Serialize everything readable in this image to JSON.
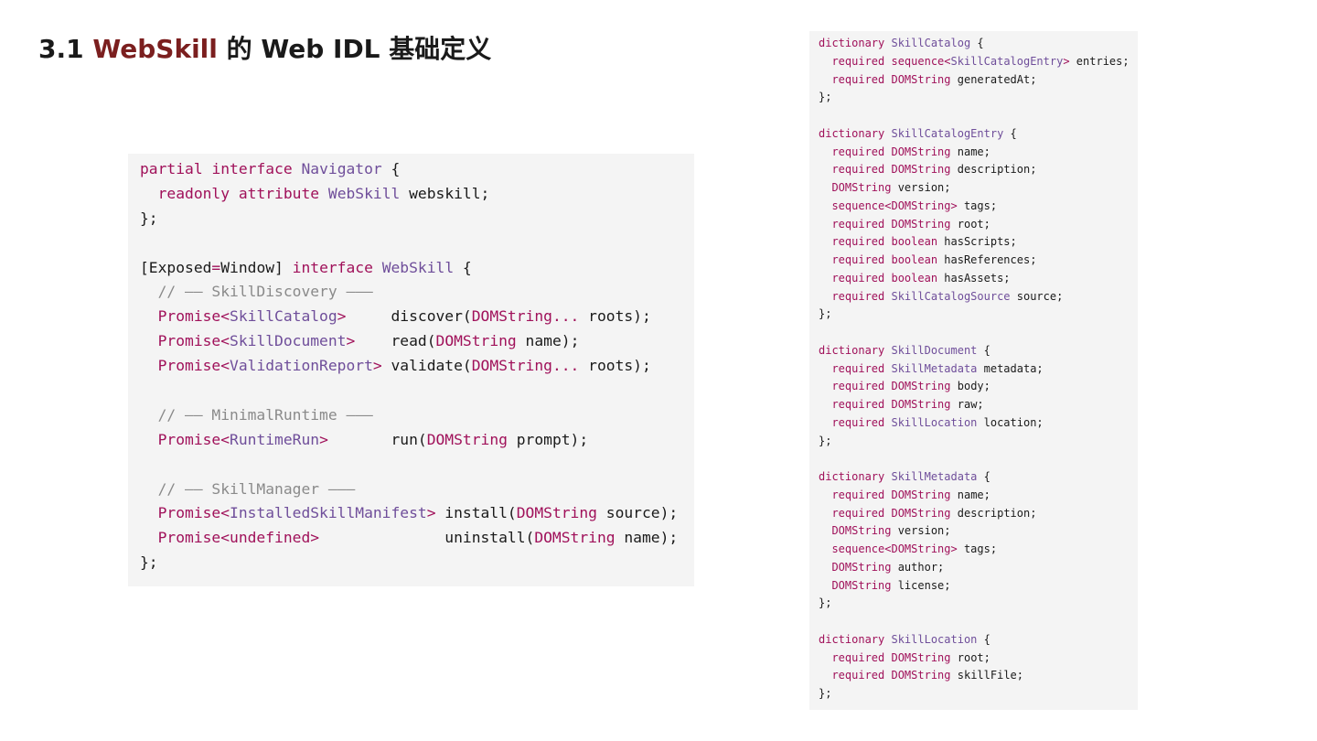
{
  "title": {
    "prefix": "3.1 ",
    "brand": "WebSkill",
    "suffix": " 的 Web IDL 基础定义"
  },
  "colors": {
    "brand": "#7b1f1f",
    "keyword": "#a0115a",
    "type": "#6f4e9a",
    "comment": "#8a8a8a",
    "text": "#1a1a1a",
    "code_background": "#f4f4f4"
  },
  "left_code": [
    [
      [
        "kw",
        "partial"
      ],
      [
        "pl",
        " "
      ],
      [
        "kw",
        "interface"
      ],
      [
        "pl",
        " "
      ],
      [
        "ty",
        "Navigator"
      ],
      [
        "pl",
        " {"
      ]
    ],
    [
      [
        "pl",
        "  "
      ],
      [
        "kw",
        "readonly"
      ],
      [
        "pl",
        " "
      ],
      [
        "kw",
        "attribute"
      ],
      [
        "pl",
        " "
      ],
      [
        "ty",
        "WebSkill"
      ],
      [
        "pl",
        " webskill;"
      ]
    ],
    [
      [
        "pl",
        "};"
      ]
    ],
    [],
    [
      [
        "pl",
        "[Exposed"
      ],
      [
        "kw",
        "="
      ],
      [
        "pl",
        "Window] "
      ],
      [
        "kw",
        "interface"
      ],
      [
        "pl",
        " "
      ],
      [
        "ty",
        "WebSkill"
      ],
      [
        "pl",
        " {"
      ]
    ],
    [
      [
        "cm",
        "  // —— SkillDiscovery ———"
      ]
    ],
    [
      [
        "pl",
        "  "
      ],
      [
        "kw",
        "Promise<"
      ],
      [
        "ty",
        "SkillCatalog"
      ],
      [
        "kw",
        ">"
      ],
      [
        "pl",
        "     discover("
      ],
      [
        "kw",
        "DOMString..."
      ],
      [
        "pl",
        " roots);"
      ]
    ],
    [
      [
        "pl",
        "  "
      ],
      [
        "kw",
        "Promise<"
      ],
      [
        "ty",
        "SkillDocument"
      ],
      [
        "kw",
        ">"
      ],
      [
        "pl",
        "    read("
      ],
      [
        "kw",
        "DOMString"
      ],
      [
        "pl",
        " name);"
      ]
    ],
    [
      [
        "pl",
        "  "
      ],
      [
        "kw",
        "Promise<"
      ],
      [
        "ty",
        "ValidationReport"
      ],
      [
        "kw",
        ">"
      ],
      [
        "pl",
        " validate("
      ],
      [
        "kw",
        "DOMString..."
      ],
      [
        "pl",
        " roots);"
      ]
    ],
    [],
    [
      [
        "cm",
        "  // —— MinimalRuntime ———"
      ]
    ],
    [
      [
        "pl",
        "  "
      ],
      [
        "kw",
        "Promise<"
      ],
      [
        "ty",
        "RuntimeRun"
      ],
      [
        "kw",
        ">"
      ],
      [
        "pl",
        "       run("
      ],
      [
        "kw",
        "DOMString"
      ],
      [
        "pl",
        " prompt);"
      ]
    ],
    [],
    [
      [
        "cm",
        "  // —— SkillManager ———"
      ]
    ],
    [
      [
        "pl",
        "  "
      ],
      [
        "kw",
        "Promise<"
      ],
      [
        "ty",
        "InstalledSkillManifest"
      ],
      [
        "kw",
        ">"
      ],
      [
        "pl",
        " install("
      ],
      [
        "kw",
        "DOMString"
      ],
      [
        "pl",
        " source);"
      ]
    ],
    [
      [
        "pl",
        "  "
      ],
      [
        "kw",
        "Promise<undefined>"
      ],
      [
        "pl",
        "              uninstall("
      ],
      [
        "kw",
        "DOMString"
      ],
      [
        "pl",
        " name);"
      ]
    ],
    [
      [
        "pl",
        "};"
      ]
    ]
  ],
  "right_code": [
    [
      [
        "kw",
        "dictionary"
      ],
      [
        "pl",
        " "
      ],
      [
        "ty",
        "SkillCatalog"
      ],
      [
        "pl",
        " {"
      ]
    ],
    [
      [
        "pl",
        "  "
      ],
      [
        "kw",
        "required"
      ],
      [
        "pl",
        " "
      ],
      [
        "kw",
        "sequence<"
      ],
      [
        "ty",
        "SkillCatalogEntry"
      ],
      [
        "kw",
        ">"
      ],
      [
        "pl",
        " entries;"
      ]
    ],
    [
      [
        "pl",
        "  "
      ],
      [
        "kw",
        "required"
      ],
      [
        "pl",
        " "
      ],
      [
        "kw",
        "DOMString"
      ],
      [
        "pl",
        " generatedAt;"
      ]
    ],
    [
      [
        "pl",
        "};"
      ]
    ],
    [],
    [
      [
        "kw",
        "dictionary"
      ],
      [
        "pl",
        " "
      ],
      [
        "ty",
        "SkillCatalogEntry"
      ],
      [
        "pl",
        " {"
      ]
    ],
    [
      [
        "pl",
        "  "
      ],
      [
        "kw",
        "required"
      ],
      [
        "pl",
        " "
      ],
      [
        "kw",
        "DOMString"
      ],
      [
        "pl",
        " name;"
      ]
    ],
    [
      [
        "pl",
        "  "
      ],
      [
        "kw",
        "required"
      ],
      [
        "pl",
        " "
      ],
      [
        "kw",
        "DOMString"
      ],
      [
        "pl",
        " description;"
      ]
    ],
    [
      [
        "pl",
        "  "
      ],
      [
        "kw",
        "DOMString"
      ],
      [
        "pl",
        " version;"
      ]
    ],
    [
      [
        "pl",
        "  "
      ],
      [
        "kw",
        "sequence<DOMString>"
      ],
      [
        "pl",
        " tags;"
      ]
    ],
    [
      [
        "pl",
        "  "
      ],
      [
        "kw",
        "required"
      ],
      [
        "pl",
        " "
      ],
      [
        "kw",
        "DOMString"
      ],
      [
        "pl",
        " root;"
      ]
    ],
    [
      [
        "pl",
        "  "
      ],
      [
        "kw",
        "required"
      ],
      [
        "pl",
        " "
      ],
      [
        "kw",
        "boolean"
      ],
      [
        "pl",
        " hasScripts;"
      ]
    ],
    [
      [
        "pl",
        "  "
      ],
      [
        "kw",
        "required"
      ],
      [
        "pl",
        " "
      ],
      [
        "kw",
        "boolean"
      ],
      [
        "pl",
        " hasReferences;"
      ]
    ],
    [
      [
        "pl",
        "  "
      ],
      [
        "kw",
        "required"
      ],
      [
        "pl",
        " "
      ],
      [
        "kw",
        "boolean"
      ],
      [
        "pl",
        " hasAssets;"
      ]
    ],
    [
      [
        "pl",
        "  "
      ],
      [
        "kw",
        "required"
      ],
      [
        "pl",
        " "
      ],
      [
        "ty",
        "SkillCatalogSource"
      ],
      [
        "pl",
        " source;"
      ]
    ],
    [
      [
        "pl",
        "};"
      ]
    ],
    [],
    [
      [
        "kw",
        "dictionary"
      ],
      [
        "pl",
        " "
      ],
      [
        "ty",
        "SkillDocument"
      ],
      [
        "pl",
        " {"
      ]
    ],
    [
      [
        "pl",
        "  "
      ],
      [
        "kw",
        "required"
      ],
      [
        "pl",
        " "
      ],
      [
        "ty",
        "SkillMetadata"
      ],
      [
        "pl",
        " metadata;"
      ]
    ],
    [
      [
        "pl",
        "  "
      ],
      [
        "kw",
        "required"
      ],
      [
        "pl",
        " "
      ],
      [
        "kw",
        "DOMString"
      ],
      [
        "pl",
        " body;"
      ]
    ],
    [
      [
        "pl",
        "  "
      ],
      [
        "kw",
        "required"
      ],
      [
        "pl",
        " "
      ],
      [
        "kw",
        "DOMString"
      ],
      [
        "pl",
        " raw;"
      ]
    ],
    [
      [
        "pl",
        "  "
      ],
      [
        "kw",
        "required"
      ],
      [
        "pl",
        " "
      ],
      [
        "ty",
        "SkillLocation"
      ],
      [
        "pl",
        " location;"
      ]
    ],
    [
      [
        "pl",
        "};"
      ]
    ],
    [],
    [
      [
        "kw",
        "dictionary"
      ],
      [
        "pl",
        " "
      ],
      [
        "ty",
        "SkillMetadata"
      ],
      [
        "pl",
        " {"
      ]
    ],
    [
      [
        "pl",
        "  "
      ],
      [
        "kw",
        "required"
      ],
      [
        "pl",
        " "
      ],
      [
        "kw",
        "DOMString"
      ],
      [
        "pl",
        " name;"
      ]
    ],
    [
      [
        "pl",
        "  "
      ],
      [
        "kw",
        "required"
      ],
      [
        "pl",
        " "
      ],
      [
        "kw",
        "DOMString"
      ],
      [
        "pl",
        " description;"
      ]
    ],
    [
      [
        "pl",
        "  "
      ],
      [
        "kw",
        "DOMString"
      ],
      [
        "pl",
        " version;"
      ]
    ],
    [
      [
        "pl",
        "  "
      ],
      [
        "kw",
        "sequence<DOMString>"
      ],
      [
        "pl",
        " tags;"
      ]
    ],
    [
      [
        "pl",
        "  "
      ],
      [
        "kw",
        "DOMString"
      ],
      [
        "pl",
        " author;"
      ]
    ],
    [
      [
        "pl",
        "  "
      ],
      [
        "kw",
        "DOMString"
      ],
      [
        "pl",
        " license;"
      ]
    ],
    [
      [
        "pl",
        "};"
      ]
    ],
    [],
    [
      [
        "kw",
        "dictionary"
      ],
      [
        "pl",
        " "
      ],
      [
        "ty",
        "SkillLocation"
      ],
      [
        "pl",
        " {"
      ]
    ],
    [
      [
        "pl",
        "  "
      ],
      [
        "kw",
        "required"
      ],
      [
        "pl",
        " "
      ],
      [
        "kw",
        "DOMString"
      ],
      [
        "pl",
        " root;"
      ]
    ],
    [
      [
        "pl",
        "  "
      ],
      [
        "kw",
        "required"
      ],
      [
        "pl",
        " "
      ],
      [
        "kw",
        "DOMString"
      ],
      [
        "pl",
        " skillFile;"
      ]
    ],
    [
      [
        "pl",
        "};"
      ]
    ]
  ]
}
